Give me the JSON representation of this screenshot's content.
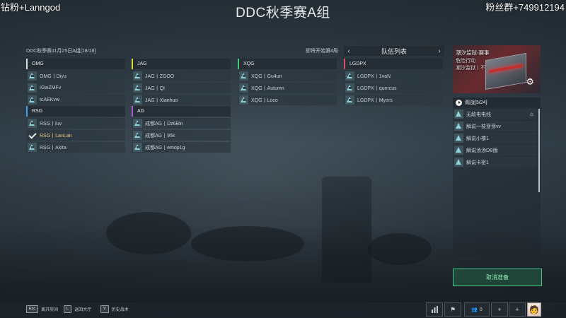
{
  "header": {
    "left_overlay": "钻粉+Lanngod",
    "right_overlay": "粉丝群+749912194",
    "title": "DDC秋季赛A组"
  },
  "match_info": "DDC秋季赛11月25日A组[18/18]",
  "countdown": "即将开始第4局",
  "team_colors": {
    "OMG": "#d8dde2",
    "JAG": "#e0d53a",
    "XQG": "#3ccf7a",
    "LGDPX": "#e04a6a",
    "RSG": "#4aa0e8",
    "AG": "#b45ad8"
  },
  "teams": [
    {
      "name": "OMG",
      "members": [
        "OMG丨Diyu",
        "IGwZMFv",
        "tcAEKvw"
      ]
    },
    {
      "name": "JAG",
      "members": [
        "JAG丨ZGOO",
        "JAG丨QI",
        "JAG丨Xianhuo"
      ]
    },
    {
      "name": "XQG",
      "members": [
        "XQG丨Gu4un",
        "XQG丨Autumn",
        "XQG丨Loco"
      ]
    },
    {
      "name": "LGDPX",
      "members": [
        "LGDPX丨1vaN",
        "LGDPX丨quercus",
        "LGDPX丨Myers"
      ]
    },
    {
      "name": "RSG",
      "members": [
        "RSG丨luv",
        "RSG丨LanLan",
        "RSG丨Akita"
      ]
    },
    {
      "name": "AG",
      "members": [
        "成都AG丨Dz6Bin",
        "成都AG丨95k",
        "成都AG丨emop1g"
      ]
    }
  ],
  "ready_member": "RSG丨LanLan",
  "roster_panel": {
    "label": "队伍列表",
    "prev_icon": "chevron-left-icon",
    "next_icon": "chevron-right-icon"
  },
  "event_card": {
    "title": "潮汐监狱-赛事",
    "line1": "危险行动",
    "line2": "潮汐监狱丨不",
    "settings_icon": "gear-icon"
  },
  "spectators": {
    "header": "观战[5/24]",
    "items": [
      "无敌电电线",
      "解说一枝芽芽vv",
      "解说小楼1",
      "解说汤汤DB版",
      "解说卡密1"
    ],
    "host_icon": "home-icon"
  },
  "cancel_button": "取消准备",
  "bottom_hints": [
    {
      "key": "Esc",
      "label": "离开房间"
    },
    {
      "key": "L",
      "label": "返回大厅"
    },
    {
      "key": "V",
      "label": "历史战术"
    }
  ],
  "bottom_buttons": {
    "stats_icon": "bar-chart-icon",
    "flag_icon": "flag-icon",
    "friends_icon": "friends-icon",
    "friends_count": "0",
    "add_label": "+",
    "add2_label": "+"
  }
}
